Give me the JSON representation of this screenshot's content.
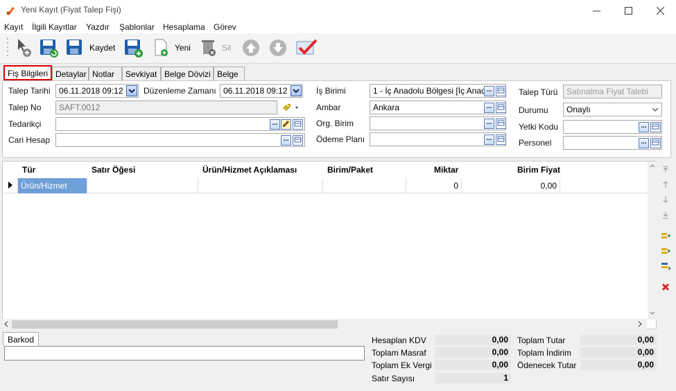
{
  "window": {
    "title": "Yeni Kayıt (Fiyat Talep Fişi)"
  },
  "menu": [
    "Kayıt",
    "İlgili Kayıtlar",
    "Yazdır",
    "Şablonlar",
    "Hesaplama",
    "Görev"
  ],
  "toolbar": {
    "save_label": "Kaydet",
    "new_label": "Yeni",
    "delete_label": "Sil"
  },
  "tabs": [
    "Fiş Bilgileri",
    "Detaylar",
    "Notlar",
    "Sevkiyat",
    "Belge Dövizi",
    "Belge"
  ],
  "form": {
    "talep_tarihi_label": "Talep Tarihi",
    "talep_tarihi": "06.11.2018 09:12",
    "duzenleme_label": "Düzenleme Zamanı",
    "duzenleme": "06.11.2018 09:12",
    "talep_no_label": "Talep No",
    "talep_no": "SAFT.0012",
    "tedarikci_label": "Tedarikçi",
    "tedarikci": "",
    "cari_label": "Cari Hesap",
    "cari": "",
    "is_birimi_label": "İş Birimi",
    "is_birimi": "1 - İç Anadolu Bölgesi [İç Anad",
    "ambar_label": "Ambar",
    "ambar": "Ankara",
    "org_label": "Org. Birim",
    "org": "",
    "odeme_label": "Ödeme Planı",
    "odeme": "",
    "talep_turu_label": "Talep Türü",
    "talep_turu": "Satınalma Fiyat Talebi",
    "durumu_label": "Durumu",
    "durumu": "Onaylı",
    "yetki_label": "Yetki Kodu",
    "yetki": "",
    "personel_label": "Personel",
    "personel": "",
    "ellipsis": "..."
  },
  "grid": {
    "columns": [
      "Tür",
      "Satır Öğesi",
      "Ürün/Hizmet Açıklaması",
      "Birim/Paket",
      "Miktar",
      "Birim Fiyat"
    ],
    "row": {
      "tur": "Ürün/Hizmet",
      "miktar": "0",
      "birim_fiyat": "0,00"
    }
  },
  "barkod": {
    "tab_label": "Barkod",
    "value": ""
  },
  "summary": {
    "hesaplan_kdv_label": "Hesaplan KDV",
    "hesaplan_kdv": "0,00",
    "masraf_label": "Toplam Masraf",
    "masraf": "0,00",
    "ek_vergi_label": "Toplam Ek Vergi",
    "ek_vergi": "0,00",
    "satir_label": "Satır Sayısı",
    "satir": "1",
    "tutar_label": "Toplam Tutar",
    "tutar": "0,00",
    "indirim_label": "Toplam İndirim",
    "indirim": "0,00",
    "odenecek_label": "Ödenecek Tutar",
    "odenecek": "0,00"
  },
  "colors": {
    "accent": "#3399ff",
    "active_tab_border": "#e00000",
    "selected_cell": "#6f9fd8"
  }
}
